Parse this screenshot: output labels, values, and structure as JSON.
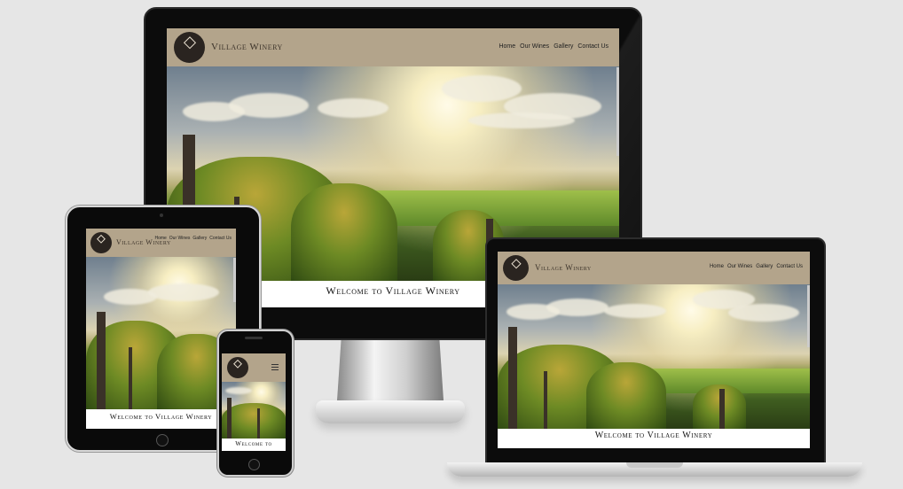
{
  "brand": "Village Winery",
  "nav": [
    "Home",
    "Our Wines",
    "Gallery",
    "Contact Us"
  ],
  "welcome": "Welcome to Village Winery",
  "phone_welcome": "Welcome to",
  "logo_text": "Village Winery",
  "colors": {
    "background": "#e6e6e6",
    "header": "#b3a48b",
    "frame": "#0c0c0c"
  },
  "icons": {
    "menu": "hamburger-menu-icon"
  }
}
